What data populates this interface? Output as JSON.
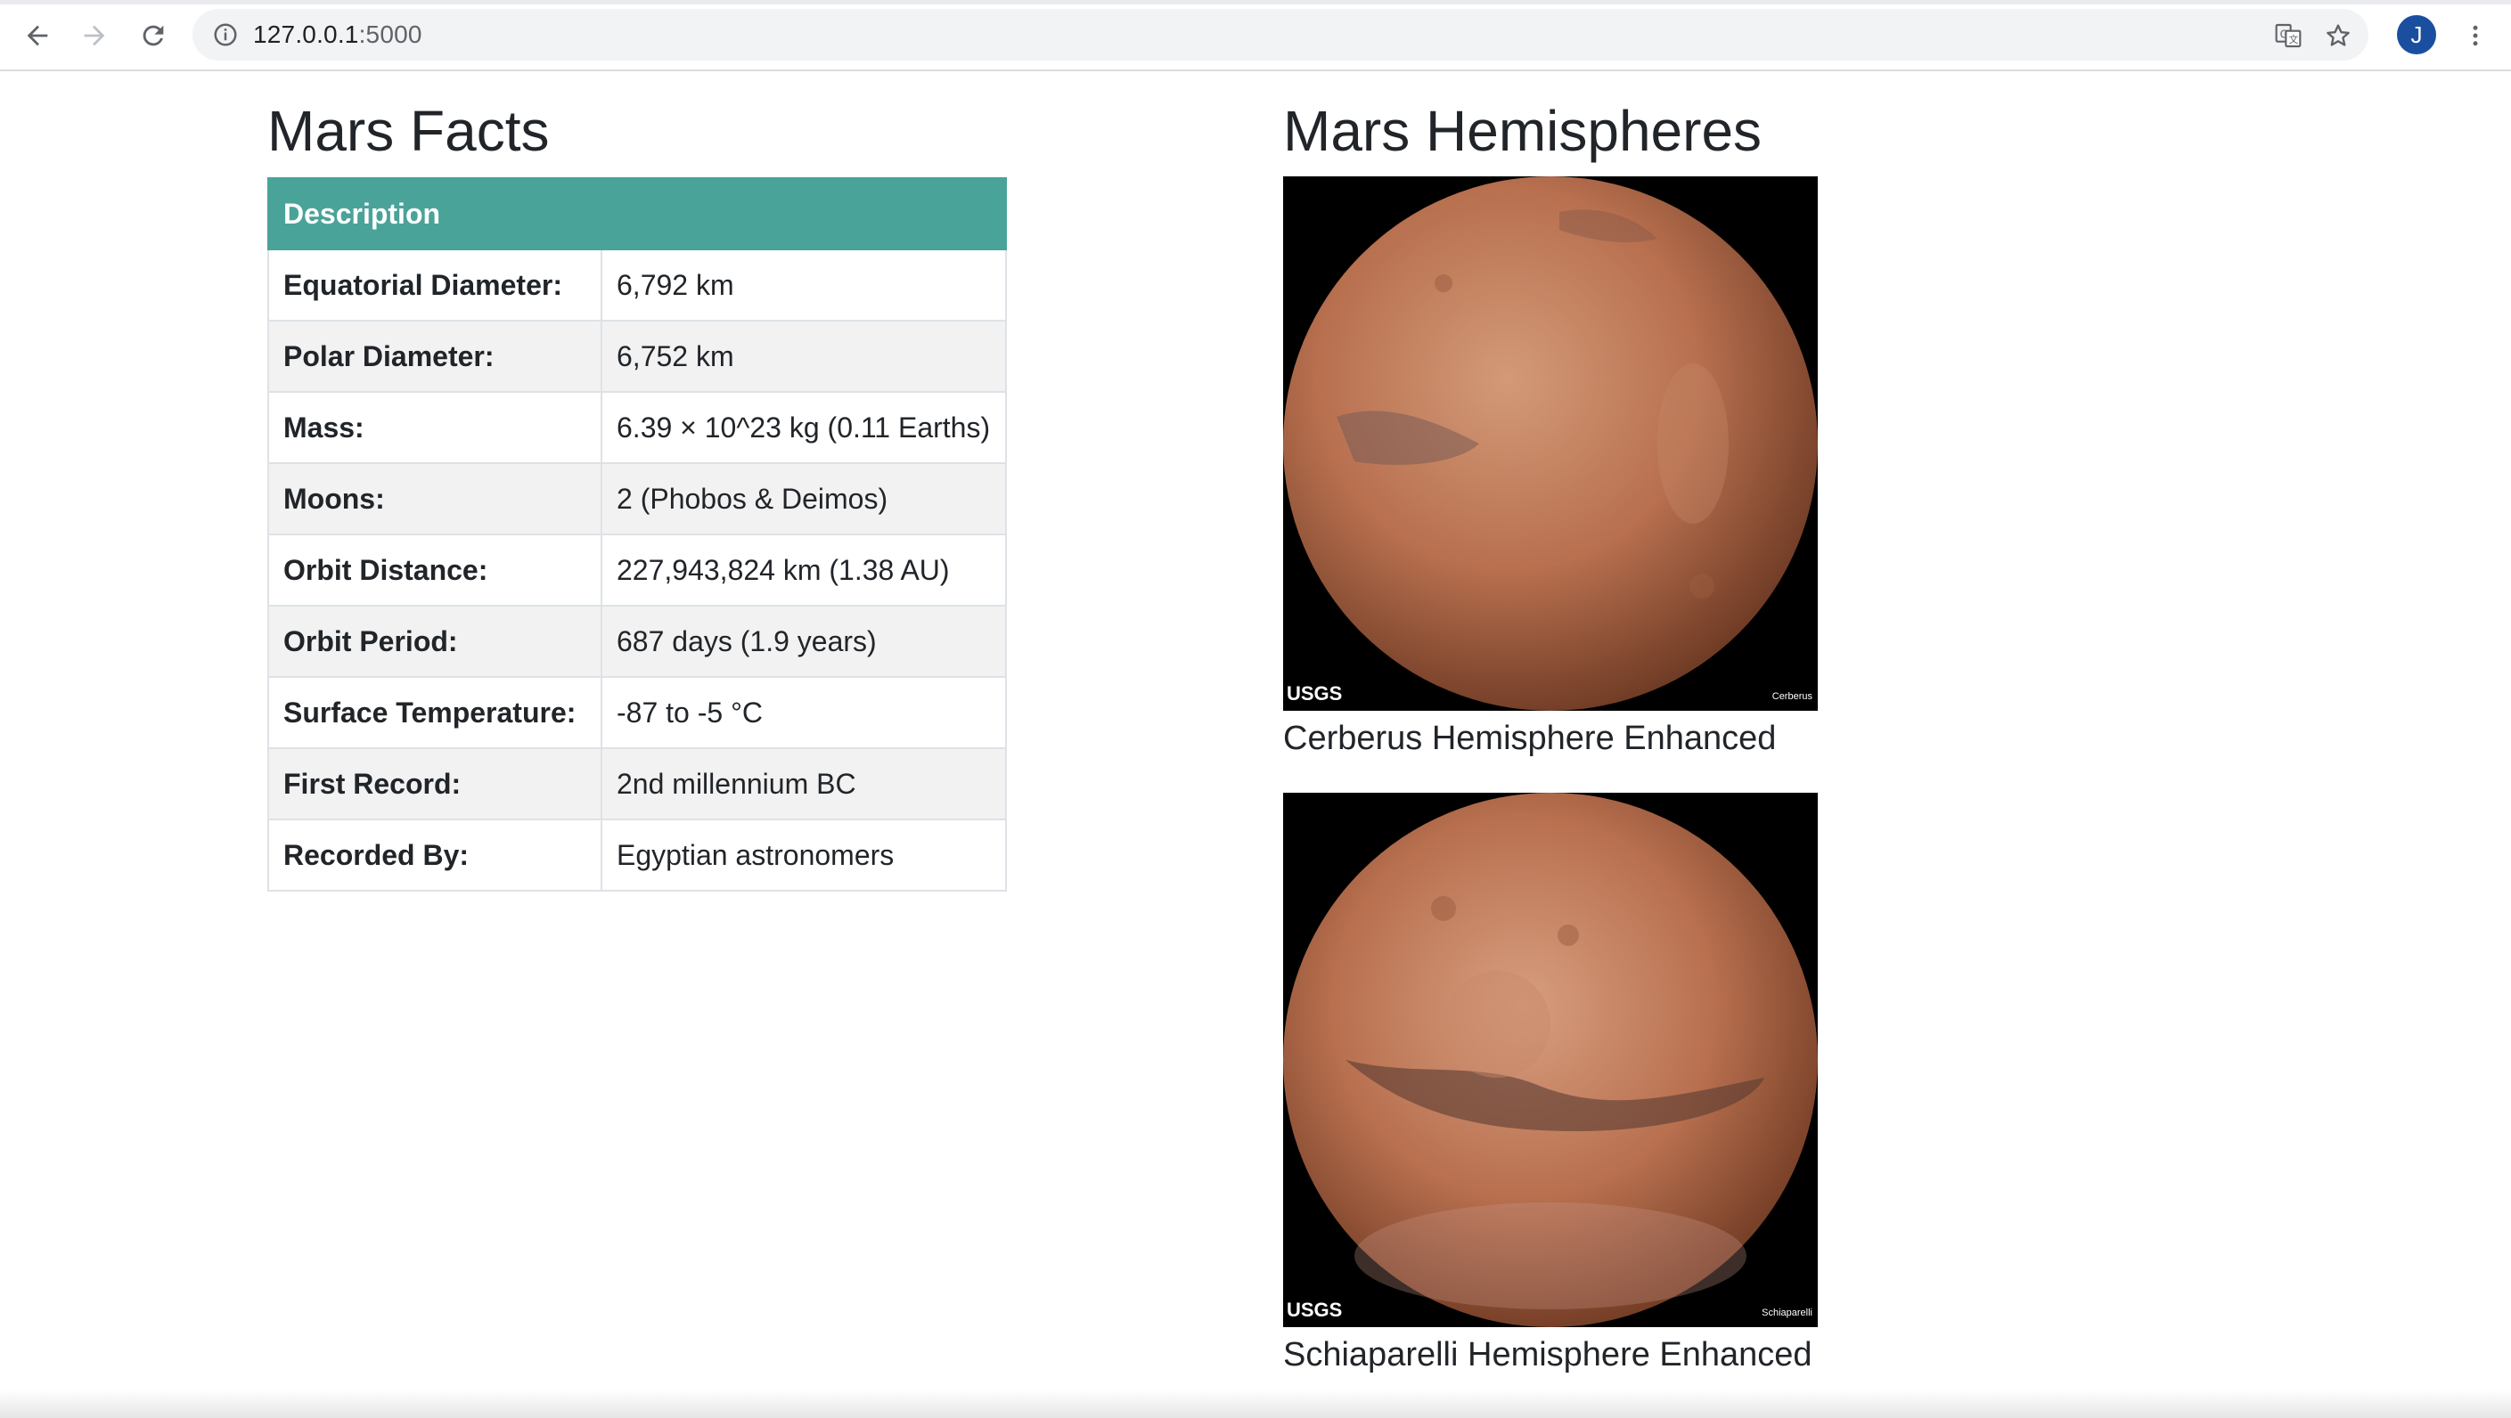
{
  "browser": {
    "url_host": "127.0.0.1",
    "url_port": ":5000",
    "avatar_letter": "J"
  },
  "facts": {
    "title": "Mars Facts",
    "header": [
      "Description",
      ""
    ],
    "rows": [
      {
        "label": "Equatorial Diameter:",
        "value": "6,792 km"
      },
      {
        "label": "Polar Diameter:",
        "value": "6,752 km"
      },
      {
        "label": "Mass:",
        "value": "6.39 × 10^23 kg (0.11 Earths)"
      },
      {
        "label": "Moons:",
        "value": "2 (Phobos & Deimos)"
      },
      {
        "label": "Orbit Distance:",
        "value": "227,943,824 km (1.38 AU)"
      },
      {
        "label": "Orbit Period:",
        "value": "687 days (1.9 years)"
      },
      {
        "label": "Surface Temperature:",
        "value": "-87 to -5 °C"
      },
      {
        "label": "First Record:",
        "value": "2nd millennium BC"
      },
      {
        "label": "Recorded By:",
        "value": "Egyptian astronomers"
      }
    ]
  },
  "hemispheres": {
    "title": "Mars Hemispheres",
    "items": [
      {
        "caption": "Cerberus Hemisphere Enhanced",
        "image_label": "Cerberus",
        "logo": "USGS"
      },
      {
        "caption": "Schiaparelli Hemisphere Enhanced",
        "image_label": "Schiaparelli",
        "logo": "USGS"
      }
    ]
  },
  "colors": {
    "table_header": "#4aa398",
    "planet": "#b8704f"
  },
  "icons": [
    "back-arrow-icon",
    "forward-arrow-icon",
    "reload-icon",
    "info-icon",
    "translate-icon",
    "star-icon",
    "more-menu-icon"
  ]
}
